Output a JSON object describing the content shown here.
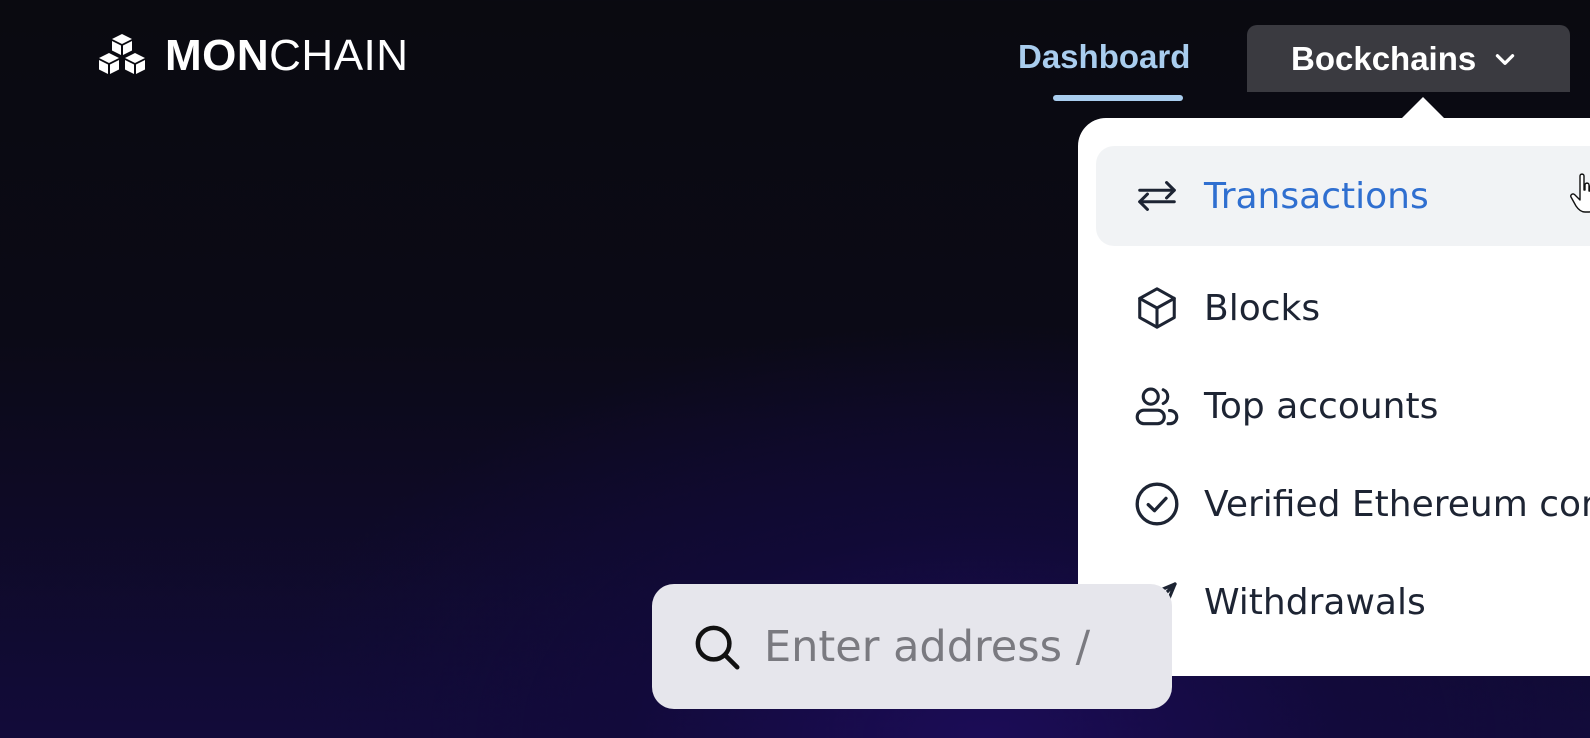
{
  "header": {
    "logo": {
      "bold": "MON",
      "light": "CHAIN",
      "icon": "cubes-logo-icon"
    },
    "nav": {
      "dashboard_label": "Dashboard",
      "blockchains_label": "Bockchains",
      "blockchains_icon": "chevron-down-icon"
    }
  },
  "dropdown": {
    "items": [
      {
        "label": "Transactions",
        "icon": "arrows-swap-icon",
        "active": true
      },
      {
        "label": "Blocks",
        "icon": "cube-icon",
        "active": false
      },
      {
        "label": "Top accounts",
        "icon": "users-icon",
        "active": false
      },
      {
        "label": "Verified Ethereum con",
        "icon": "check-circle-icon",
        "active": false
      },
      {
        "label": "Withdrawals",
        "icon": "paper-plane-icon",
        "active": false
      }
    ]
  },
  "search": {
    "placeholder": "Enter address /",
    "icon": "search-icon"
  },
  "colors": {
    "accent": "#a9cdee",
    "active_item_text": "#2f6fd0",
    "active_item_bg": "#f1f3f5",
    "menu_text": "#1d2433",
    "tab_bg": "#3a3a40"
  }
}
